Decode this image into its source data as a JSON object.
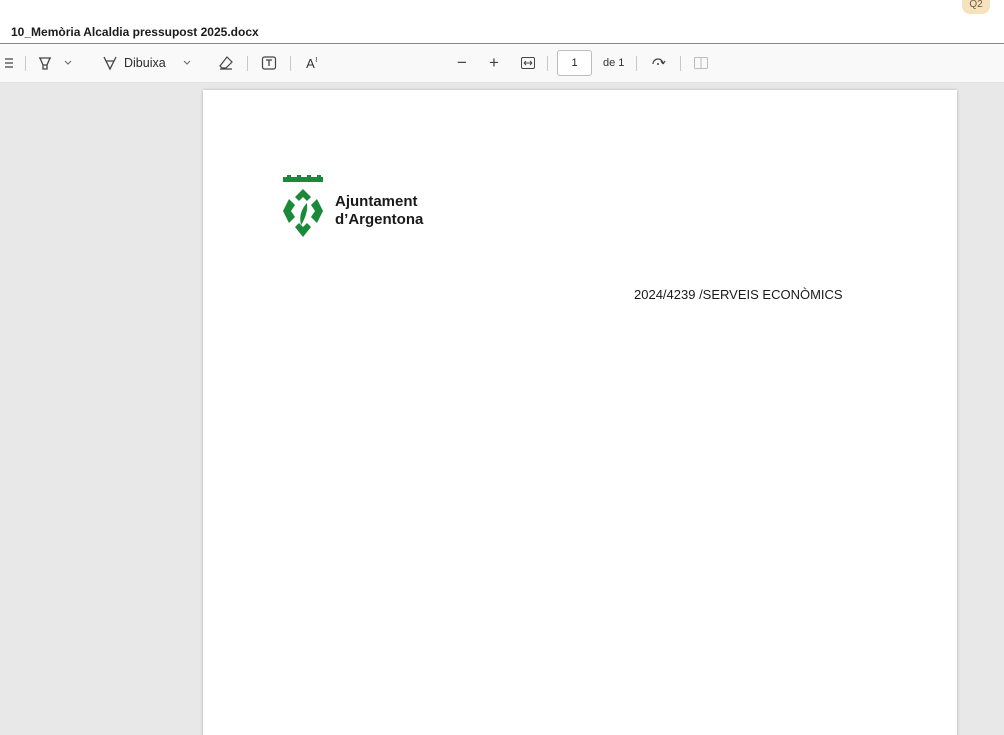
{
  "window": {
    "title": "10_Memòria Alcaldia pressupost 2025.docx",
    "corner_badge": "Q2"
  },
  "toolbar": {
    "items": [
      {
        "name": "list-icon"
      },
      {
        "name": "highlight-icon"
      },
      {
        "name": "chevron-down-icon"
      },
      {
        "name": "draw-icon",
        "label": "Dibuixa"
      },
      {
        "name": "chevron-down-icon"
      },
      {
        "name": "eraser-icon"
      },
      {
        "name": "text-box-icon"
      },
      {
        "name": "read-aloud-icon",
        "label": "A"
      },
      {
        "name": "zoom-out-icon"
      },
      {
        "name": "zoom-in-icon"
      },
      {
        "name": "fit-width-icon"
      },
      {
        "name": "rotate-icon"
      },
      {
        "name": "page-view-icon"
      }
    ],
    "draw_label": "Dibuixa",
    "read_aloud_label": "A",
    "zoom_out_label": "−",
    "zoom_in_label": "+",
    "page_current": "1",
    "page_total": "de 1"
  },
  "document": {
    "logo": {
      "line1": "Ajuntament",
      "line2": "d’Argentona",
      "brand_color": "#1a8a3a"
    },
    "reference": "2024/4239 /SERVEIS ECONÒMICS"
  }
}
